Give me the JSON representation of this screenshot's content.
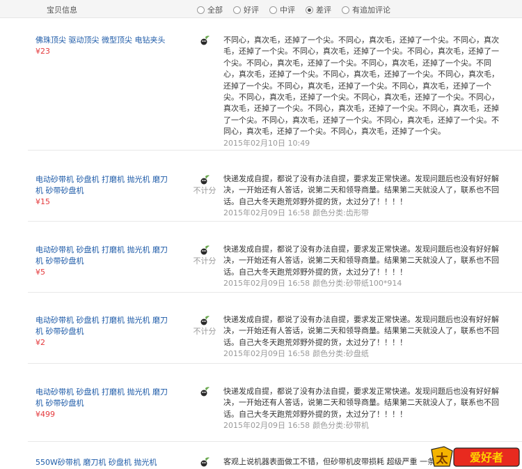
{
  "header": {
    "product_col": "宝贝信息",
    "filters": [
      {
        "label": "全部",
        "checked": false
      },
      {
        "label": "好评",
        "checked": false
      },
      {
        "label": "中评",
        "checked": false
      },
      {
        "label": "差评",
        "checked": true
      },
      {
        "label": "有追加评论",
        "checked": false
      }
    ]
  },
  "rows": [
    {
      "product": "佛珠顶尖 驱动顶尖 微型顶尖 电钻夹头",
      "price": "¥23",
      "no_count": "",
      "review": "不同心，真次毛，还掉了一个尖。不同心，真次毛，还掉了一个尖。不同心，真次毛，还掉了一个尖。不同心，真次毛，还掉了一个尖。不同心，真次毛，还掉了一个尖。不同心，真次毛，还掉了一个尖。不同心，真次毛，还掉了一个尖。不同心，真次毛，还掉了一个尖。不同心，真次毛，还掉了一个尖。不同心，真次毛，还掉了一个尖。不同心，真次毛，还掉了一个尖。不同心，真次毛，还掉了一个尖。不同心，真次毛，还掉了一个尖。不同心，真次毛，还掉了一个尖。不同心，真次毛，还掉了一个尖。不同心，真次毛，还掉了一个尖。不同心，真次毛，还掉了一个尖。不同心，真次毛，还掉了一个尖。不同心，真次毛，还掉了一个尖。不同心，真次毛，还掉了一个尖。不同心，真次毛，还掉了一个尖。",
      "date": "2015年02月10日 10:49",
      "sku": ""
    },
    {
      "product": "电动砂带机 砂盘机 打磨机 抛光机 磨刀机 砂带砂盘机",
      "price": "¥15",
      "no_count": "不计分",
      "review": "快递发成自提，都说了没有办法自提，要求发正常快递。发现问题后也没有好好解决，一开始还有人答话，说第二天和领导商量。结果第二天就没人了，联系也不回话。自己大冬天跑荒郊野外提的货，太过分了！！！！",
      "date": "2015年02月09日 16:58",
      "sku": "颜色分类:齿形带"
    },
    {
      "product": "电动砂带机 砂盘机 打磨机 抛光机 磨刀机 砂带砂盘机",
      "price": "¥5",
      "no_count": "不计分",
      "review": "快递发成自提，都说了没有办法自提，要求发正常快递。发现问题后也没有好好解决，一开始还有人答话，说第二天和领导商量。结果第二天就没人了，联系也不回话。自己大冬天跑荒郊野外提的货，太过分了！！！！",
      "date": "2015年02月09日 16:58",
      "sku": "颜色分类:砂带纸100*914"
    },
    {
      "product": "电动砂带机 砂盘机 打磨机 抛光机 磨刀机 砂带砂盘机",
      "price": "¥2",
      "no_count": "不计分",
      "review": "快递发成自提，都说了没有办法自提，要求发正常快递。发现问题后也没有好好解决，一开始还有人答话，说第二天和领导商量。结果第二天就没人了，联系也不回话。自己大冬天跑荒郊野外提的货，太过分了！！！！",
      "date": "2015年02月09日 16:58",
      "sku": "颜色分类:砂盘纸"
    },
    {
      "product": "电动砂带机 砂盘机 打磨机 抛光机 磨刀机 砂带砂盘机",
      "price": "¥499",
      "no_count": "",
      "review": "快递发成自提，都说了没有办法自提，要求发正常快递。发现问题后也没有好好解决，一开始还有人答话，说第二天和领导商量。结果第二天就没人了，联系也不回话。自己大冬天跑荒郊野外提的货，太过分了！！！！",
      "date": "2015年02月09日 16:58",
      "sku": "颜色分类:砂带机"
    },
    {
      "product": "550W砂带机 磨刀机 砂盘机 抛光机",
      "price": "",
      "no_count": "",
      "review": "客观上说机器表面做工不错，但砂带机皮带损耗 超级严重 一条",
      "date": "",
      "sku": ""
    }
  ],
  "colors": {
    "link": "#1e5ba8",
    "price": "#e4393c",
    "muted": "#999999",
    "negative_icon": "#2a2a2a",
    "leaf": "#6aa84f"
  },
  "watermark_text": "太平洋 爱好者"
}
